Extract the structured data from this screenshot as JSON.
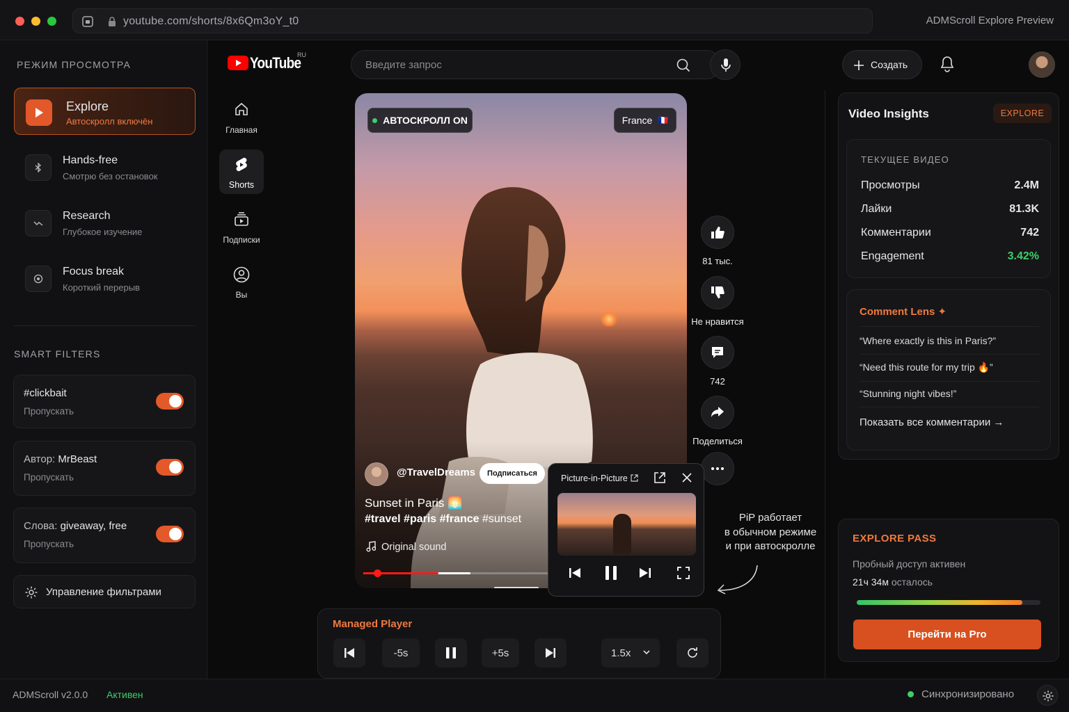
{
  "browser": {
    "url": "youtube.com/shorts/8x6Qm3oY_t0",
    "app_title": "ADMScroll Explore Preview"
  },
  "sidebar": {
    "heading": "РЕЖИМ ПРОСМОТРА",
    "modes": [
      {
        "title": "Explore",
        "subtitle": "Автоскролл включён",
        "active": true
      },
      {
        "title": "Hands-free",
        "subtitle": "Смотрю без остановок",
        "active": false
      },
      {
        "title": "Research",
        "subtitle": "Глубокое изучение",
        "active": false
      },
      {
        "title": "Focus break",
        "subtitle": "Короткий перерыв",
        "active": false
      }
    ],
    "filters_heading": "SMART FILTERS",
    "filters": [
      {
        "prefix": "",
        "value": "#clickbait",
        "action": "Пропускать",
        "enabled": true
      },
      {
        "prefix": "Автор: ",
        "value": "MrBeast",
        "action": "Пропускать",
        "enabled": true
      },
      {
        "prefix": "Слова: ",
        "value": "giveaway, free",
        "action": "Пропускать",
        "enabled": true
      }
    ],
    "manage_label": "Управление фильтрами"
  },
  "youtube": {
    "logo": "YouTube",
    "region": "RU",
    "search_placeholder": "Введите запрос",
    "create_label": "Создать"
  },
  "nav": [
    {
      "label": "Главная",
      "active": false
    },
    {
      "label": "Shorts",
      "active": true
    },
    {
      "label": "Подписки",
      "active": false
    },
    {
      "label": "Вы",
      "active": false
    }
  ],
  "video": {
    "autoscroll_label": "АВТОСКРОЛЛ ON",
    "region_label": "France",
    "region_flag": "🇫🇷",
    "channel": "@TravelDreams",
    "subscribe_label": "Подписаться",
    "title": "Sunset in Paris 🌅",
    "hashtags_bold": "#travel #paris #france",
    "hashtags_plain": "#sunset",
    "sound": "Original sound",
    "progress": 0.24,
    "buffered": 0.34
  },
  "actions": [
    {
      "label": "81 тыс.",
      "icon": "thumbs-up-icon"
    },
    {
      "label": "Не нравится",
      "icon": "thumbs-down-icon"
    },
    {
      "label": "742",
      "icon": "comment-icon"
    },
    {
      "label": "Поделиться",
      "icon": "share-icon"
    }
  ],
  "pip": {
    "title": "Picture-in-Picture",
    "note": [
      "PiP работает",
      "в обычном режиме",
      "и при автоскролле"
    ]
  },
  "player": {
    "title": "Managed Player",
    "back_label": "-5s",
    "forward_label": "+5s",
    "speed": "1.5x"
  },
  "insights": {
    "title": "Video Insights",
    "badge": "EXPLORE",
    "section": "ТЕКУЩЕЕ ВИДЕО",
    "stats": [
      {
        "label": "Просмотры",
        "value": "2.4M"
      },
      {
        "label": "Лайки",
        "value": "81.3K"
      },
      {
        "label": "Комментарии",
        "value": "742"
      },
      {
        "label": "Engagement",
        "value": "3.42%"
      }
    ],
    "comment_lens_title": "Comment Lens ✦",
    "comments": [
      "“Where exactly is this in Paris?”",
      "“Need this route for my trip 🔥”",
      "“Stunning night vibes!”"
    ],
    "show_all": "Показать все комментарии →"
  },
  "pass": {
    "title": "EXPLORE PASS",
    "line1": "Пробный доступ активен",
    "hours": "21ч 34м",
    "remaining": "осталось",
    "cta": "Перейти на Pro",
    "remaining_fraction": 0.9
  },
  "statusbar": {
    "version": "ADMScroll v2.0.0",
    "state": "Активен",
    "sync": "Синхронизировано"
  },
  "colors": {
    "accent": "#e4592a",
    "green": "#3ccf6b",
    "bg": "#0b0b0c"
  }
}
